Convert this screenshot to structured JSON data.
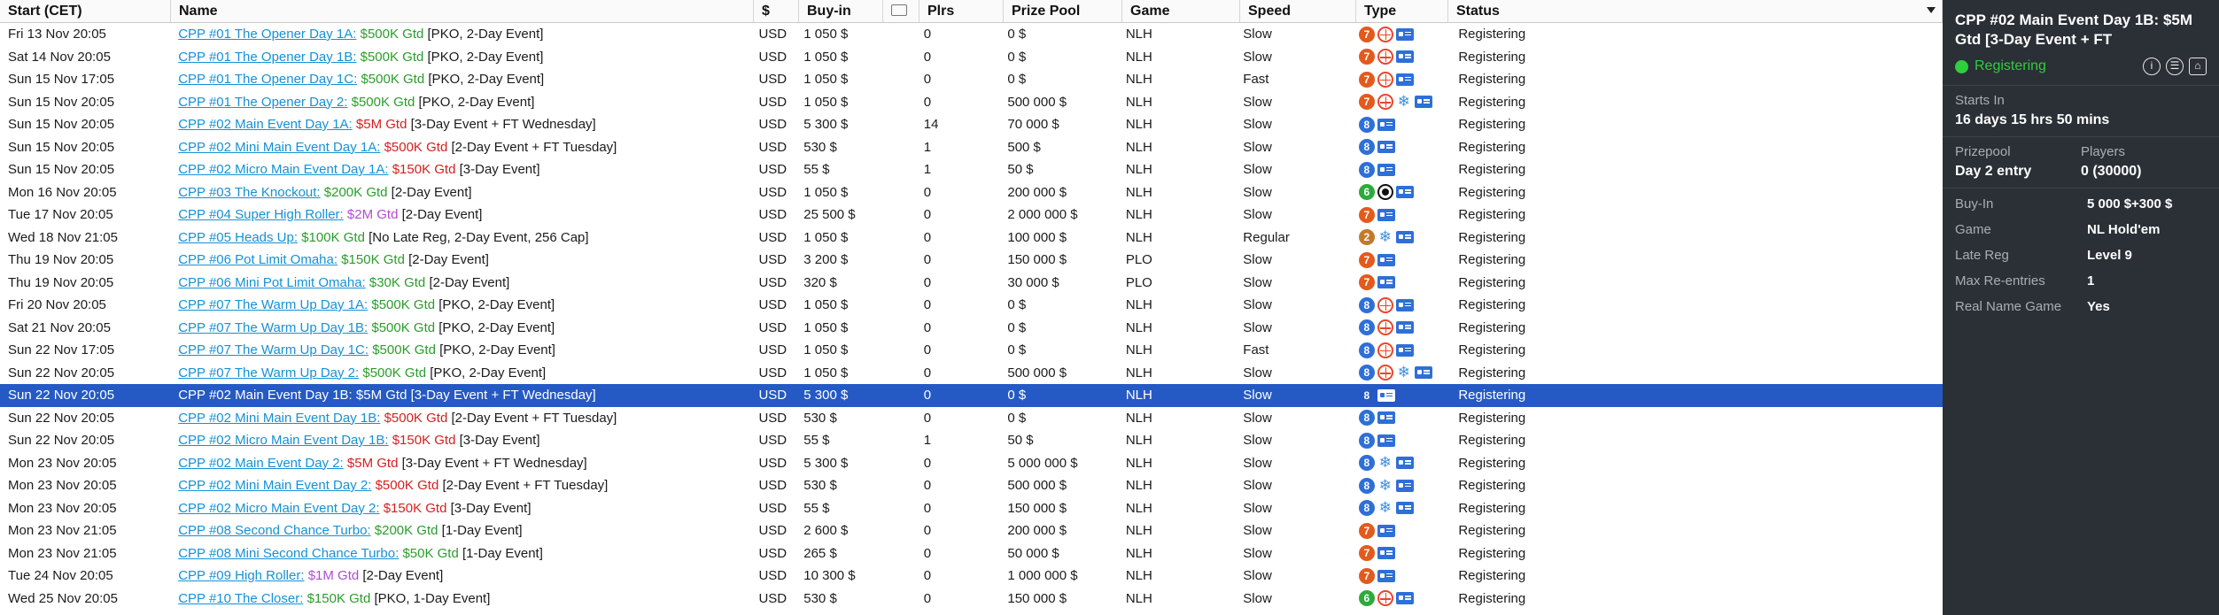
{
  "columns": {
    "start": "Start (CET)",
    "name": "Name",
    "currency": "$",
    "buyin": "Buy-in",
    "players": "Plrs",
    "prizepool": "Prize Pool",
    "game": "Game",
    "speed": "Speed",
    "type": "Type",
    "status": "Status"
  },
  "colors": {
    "selected_row": "#2559c4",
    "link": "#1591d6",
    "gtd_green": "#2a9d2a",
    "gtd_red": "#d41f1f",
    "gtd_purple": "#b44ad4",
    "panel_bg": "#2b2f36",
    "registering_green": "#2fce3e"
  },
  "rows": [
    {
      "start": "Fri 13 Nov 20:05",
      "link": "CPP #01 The Opener Day 1A:",
      "gtd": "$500K Gtd",
      "gtd_color": "green",
      "rest": "[PKO, 2-Day Event]",
      "cur": "USD",
      "buyin": "1 050 $",
      "plrs": "0",
      "pool": "0 $",
      "game": "NLH",
      "speed": "Slow",
      "icons": [
        "n7",
        "ko",
        "card"
      ],
      "status": "Registering"
    },
    {
      "start": "Sat 14 Nov 20:05",
      "link": "CPP #01 The Opener Day 1B:",
      "gtd": "$500K Gtd",
      "gtd_color": "green",
      "rest": "[PKO, 2-Day Event]",
      "cur": "USD",
      "buyin": "1 050 $",
      "plrs": "0",
      "pool": "0 $",
      "game": "NLH",
      "speed": "Slow",
      "icons": [
        "n7",
        "ko",
        "card"
      ],
      "status": "Registering"
    },
    {
      "start": "Sun 15 Nov 17:05",
      "link": "CPP #01 The Opener Day 1C:",
      "gtd": "$500K Gtd",
      "gtd_color": "green",
      "rest": "[PKO, 2-Day Event]",
      "cur": "USD",
      "buyin": "1 050 $",
      "plrs": "0",
      "pool": "0 $",
      "game": "NLH",
      "speed": "Fast",
      "icons": [
        "n7",
        "ko",
        "card"
      ],
      "status": "Registering"
    },
    {
      "start": "Sun 15 Nov 20:05",
      "link": "CPP #01 The Opener Day 2:",
      "gtd": "$500K Gtd",
      "gtd_color": "green",
      "rest": "[PKO, 2-Day Event]",
      "cur": "USD",
      "buyin": "1 050 $",
      "plrs": "0",
      "pool": "500 000 $",
      "game": "NLH",
      "speed": "Slow",
      "icons": [
        "n7",
        "ko",
        "snow",
        "card"
      ],
      "status": "Registering"
    },
    {
      "start": "Sun 15 Nov 20:05",
      "link": "CPP #02 Main Event Day 1A:",
      "gtd": "$5M Gtd",
      "gtd_color": "red",
      "rest": "[3-Day Event + FT Wednesday]",
      "cur": "USD",
      "buyin": "5 300 $",
      "plrs": "14",
      "pool": "70 000 $",
      "game": "NLH",
      "speed": "Slow",
      "icons": [
        "b8",
        "card"
      ],
      "status": "Registering"
    },
    {
      "start": "Sun 15 Nov 20:05",
      "link": "CPP #02 Mini Main Event Day 1A:",
      "gtd": "$500K Gtd",
      "gtd_color": "red",
      "rest": "[2-Day Event + FT Tuesday]",
      "cur": "USD",
      "buyin": "530 $",
      "plrs": "1",
      "pool": "500 $",
      "game": "NLH",
      "speed": "Slow",
      "icons": [
        "b8",
        "card"
      ],
      "status": "Registering"
    },
    {
      "start": "Sun 15 Nov 20:05",
      "link": "CPP #02 Micro Main Event Day 1A:",
      "gtd": "$150K Gtd",
      "gtd_color": "red",
      "rest": "[3-Day Event]",
      "cur": "USD",
      "buyin": "55 $",
      "plrs": "1",
      "pool": "50 $",
      "game": "NLH",
      "speed": "Slow",
      "icons": [
        "b8",
        "card"
      ],
      "status": "Registering"
    },
    {
      "start": "Mon 16 Nov 20:05",
      "link": "CPP #03 The Knockout:",
      "gtd": "$200K Gtd",
      "gtd_color": "green",
      "rest": "[2-Day Event]",
      "cur": "USD",
      "buyin": "1 050 $",
      "plrs": "0",
      "pool": "200 000 $",
      "game": "NLH",
      "speed": "Slow",
      "icons": [
        "g6",
        "tgt",
        "card"
      ],
      "status": "Registering"
    },
    {
      "start": "Tue 17 Nov 20:05",
      "link": "CPP #04 Super High Roller:",
      "gtd": "$2M Gtd",
      "gtd_color": "purple",
      "rest": "[2-Day Event]",
      "cur": "USD",
      "buyin": "25 500 $",
      "plrs": "0",
      "pool": "2 000 000 $",
      "game": "NLH",
      "speed": "Slow",
      "icons": [
        "n7",
        "card"
      ],
      "status": "Registering"
    },
    {
      "start": "Wed 18 Nov 21:05",
      "link": "CPP #05 Heads Up:",
      "gtd": "$100K Gtd",
      "gtd_color": "green",
      "rest": "[No Late Reg, 2-Day Event, 256 Cap]",
      "cur": "USD",
      "buyin": "1 050 $",
      "plrs": "0",
      "pool": "100 000 $",
      "game": "NLH",
      "speed": "Regular",
      "icons": [
        "o2",
        "snow",
        "card"
      ],
      "status": "Registering"
    },
    {
      "start": "Thu 19 Nov 20:05",
      "link": "CPP #06 Pot Limit Omaha:",
      "gtd": "$150K Gtd",
      "gtd_color": "green",
      "rest": "[2-Day Event]",
      "cur": "USD",
      "buyin": "3 200 $",
      "plrs": "0",
      "pool": "150 000 $",
      "game": "PLO",
      "speed": "Slow",
      "icons": [
        "n7",
        "card"
      ],
      "status": "Registering"
    },
    {
      "start": "Thu 19 Nov 20:05",
      "link": "CPP #06 Mini Pot Limit Omaha:",
      "gtd": "$30K Gtd",
      "gtd_color": "green",
      "rest": "[2-Day Event]",
      "cur": "USD",
      "buyin": "320 $",
      "plrs": "0",
      "pool": "30 000 $",
      "game": "PLO",
      "speed": "Slow",
      "icons": [
        "n7",
        "card"
      ],
      "status": "Registering"
    },
    {
      "start": "Fri 20 Nov 20:05",
      "link": "CPP #07 The Warm Up Day 1A:",
      "gtd": "$500K Gtd",
      "gtd_color": "green",
      "rest": "[PKO, 2-Day Event]",
      "cur": "USD",
      "buyin": "1 050 $",
      "plrs": "0",
      "pool": "0 $",
      "game": "NLH",
      "speed": "Slow",
      "icons": [
        "b8",
        "ko",
        "card"
      ],
      "status": "Registering"
    },
    {
      "start": "Sat 21 Nov 20:05",
      "link": "CPP #07 The Warm Up Day 1B:",
      "gtd": "$500K Gtd",
      "gtd_color": "green",
      "rest": "[PKO, 2-Day Event]",
      "cur": "USD",
      "buyin": "1 050 $",
      "plrs": "0",
      "pool": "0 $",
      "game": "NLH",
      "speed": "Slow",
      "icons": [
        "b8",
        "ko",
        "card"
      ],
      "status": "Registering"
    },
    {
      "start": "Sun 22 Nov 17:05",
      "link": "CPP #07 The Warm Up Day 1C:",
      "gtd": "$500K Gtd",
      "gtd_color": "green",
      "rest": "[PKO, 2-Day Event]",
      "cur": "USD",
      "buyin": "1 050 $",
      "plrs": "0",
      "pool": "0 $",
      "game": "NLH",
      "speed": "Fast",
      "icons": [
        "b8",
        "ko",
        "card"
      ],
      "status": "Registering"
    },
    {
      "start": "Sun 22 Nov 20:05",
      "link": "CPP #07 The Warm Up Day 2:",
      "gtd": "$500K Gtd",
      "gtd_color": "green",
      "rest": "[PKO, 2-Day Event]",
      "cur": "USD",
      "buyin": "1 050 $",
      "plrs": "0",
      "pool": "500 000 $",
      "game": "NLH",
      "speed": "Slow",
      "icons": [
        "b8",
        "ko",
        "snow",
        "card"
      ],
      "status": "Registering"
    },
    {
      "start": "Sun 22 Nov 20:05",
      "link": "CPP #02 Main Event Day 1B:",
      "gtd": "$5M Gtd",
      "gtd_color": "red",
      "rest": "[3-Day Event + FT Wednesday]",
      "cur": "USD",
      "buyin": "5 300 $",
      "plrs": "0",
      "pool": "0 $",
      "game": "NLH",
      "speed": "Slow",
      "icons": [
        "p8",
        "card"
      ],
      "status": "Registering",
      "selected": true
    },
    {
      "start": "Sun 22 Nov 20:05",
      "link": "CPP #02 Mini Main Event Day 1B:",
      "gtd": "$500K Gtd",
      "gtd_color": "red",
      "rest": "[2-Day Event + FT Tuesday]",
      "cur": "USD",
      "buyin": "530 $",
      "plrs": "0",
      "pool": "0 $",
      "game": "NLH",
      "speed": "Slow",
      "icons": [
        "b8",
        "card"
      ],
      "status": "Registering"
    },
    {
      "start": "Sun 22 Nov 20:05",
      "link": "CPP #02 Micro Main Event Day 1B:",
      "gtd": "$150K Gtd",
      "gtd_color": "red",
      "rest": "[3-Day Event]",
      "cur": "USD",
      "buyin": "55 $",
      "plrs": "1",
      "pool": "50 $",
      "game": "NLH",
      "speed": "Slow",
      "icons": [
        "b8",
        "card"
      ],
      "status": "Registering"
    },
    {
      "start": "Mon 23 Nov 20:05",
      "link": "CPP #02 Main Event Day 2:",
      "gtd": "$5M Gtd",
      "gtd_color": "red",
      "rest": "[3-Day Event + FT Wednesday]",
      "cur": "USD",
      "buyin": "5 300 $",
      "plrs": "0",
      "pool": "5 000 000 $",
      "game": "NLH",
      "speed": "Slow",
      "icons": [
        "b8",
        "snow",
        "card"
      ],
      "status": "Registering"
    },
    {
      "start": "Mon 23 Nov 20:05",
      "link": "CPP #02 Mini Main Event Day 2:",
      "gtd": "$500K Gtd",
      "gtd_color": "red",
      "rest": "[2-Day Event + FT Tuesday]",
      "cur": "USD",
      "buyin": "530 $",
      "plrs": "0",
      "pool": "500 000 $",
      "game": "NLH",
      "speed": "Slow",
      "icons": [
        "b8",
        "snow",
        "card"
      ],
      "status": "Registering"
    },
    {
      "start": "Mon 23 Nov 20:05",
      "link": "CPP #02 Micro Main Event Day 2:",
      "gtd": "$150K Gtd",
      "gtd_color": "red",
      "rest": "[3-Day Event]",
      "cur": "USD",
      "buyin": "55 $",
      "plrs": "0",
      "pool": "150 000 $",
      "game": "NLH",
      "speed": "Slow",
      "icons": [
        "b8",
        "snow",
        "card"
      ],
      "status": "Registering"
    },
    {
      "start": "Mon 23 Nov 21:05",
      "link": "CPP #08 Second Chance Turbo:",
      "gtd": "$200K Gtd",
      "gtd_color": "green",
      "rest": "[1-Day Event]",
      "cur": "USD",
      "buyin": "2 600 $",
      "plrs": "0",
      "pool": "200 000 $",
      "game": "NLH",
      "speed": "Slow",
      "icons": [
        "n7",
        "card"
      ],
      "status": "Registering"
    },
    {
      "start": "Mon 23 Nov 21:05",
      "link": "CPP #08 Mini Second Chance Turbo:",
      "gtd": "$50K Gtd",
      "gtd_color": "green",
      "rest": "[1-Day Event]",
      "cur": "USD",
      "buyin": "265 $",
      "plrs": "0",
      "pool": "50 000 $",
      "game": "NLH",
      "speed": "Slow",
      "icons": [
        "n7",
        "card"
      ],
      "status": "Registering"
    },
    {
      "start": "Tue 24 Nov 20:05",
      "link": "CPP #09 High Roller:",
      "gtd": "$1M Gtd",
      "gtd_color": "purple",
      "rest": "[2-Day Event]",
      "cur": "USD",
      "buyin": "10 300 $",
      "plrs": "0",
      "pool": "1 000 000 $",
      "game": "NLH",
      "speed": "Slow",
      "icons": [
        "n7",
        "card"
      ],
      "status": "Registering"
    },
    {
      "start": "Wed 25 Nov 20:05",
      "link": "CPP #10 The Closer:",
      "gtd": "$150K Gtd",
      "gtd_color": "green",
      "rest": "[PKO, 1-Day Event]",
      "cur": "USD",
      "buyin": "530 $",
      "plrs": "0",
      "pool": "150 000 $",
      "game": "NLH",
      "speed": "Slow",
      "icons": [
        "g6",
        "ko",
        "card"
      ],
      "status": "Registering"
    }
  ],
  "panel": {
    "title": "CPP #02 Main Event Day 1B: $5M Gtd [3-Day Event + FT",
    "status": "Registering",
    "starts_in_label": "Starts In",
    "starts_in_value": "16 days 15 hrs  50 mins",
    "prizepool_label": "Prizepool",
    "prizepool_value": "Day 2 entry",
    "players_label": "Players",
    "players_value": "0 (30000)",
    "details": [
      {
        "k": "Buy-In",
        "v": "5 000 $+300 $"
      },
      {
        "k": "Game",
        "v": "NL Hold'em"
      },
      {
        "k": "Late Reg",
        "v": "Level 9"
      },
      {
        "k": "Max Re-entries",
        "v": "1"
      },
      {
        "k": "Real Name Game",
        "v": "Yes"
      }
    ]
  }
}
